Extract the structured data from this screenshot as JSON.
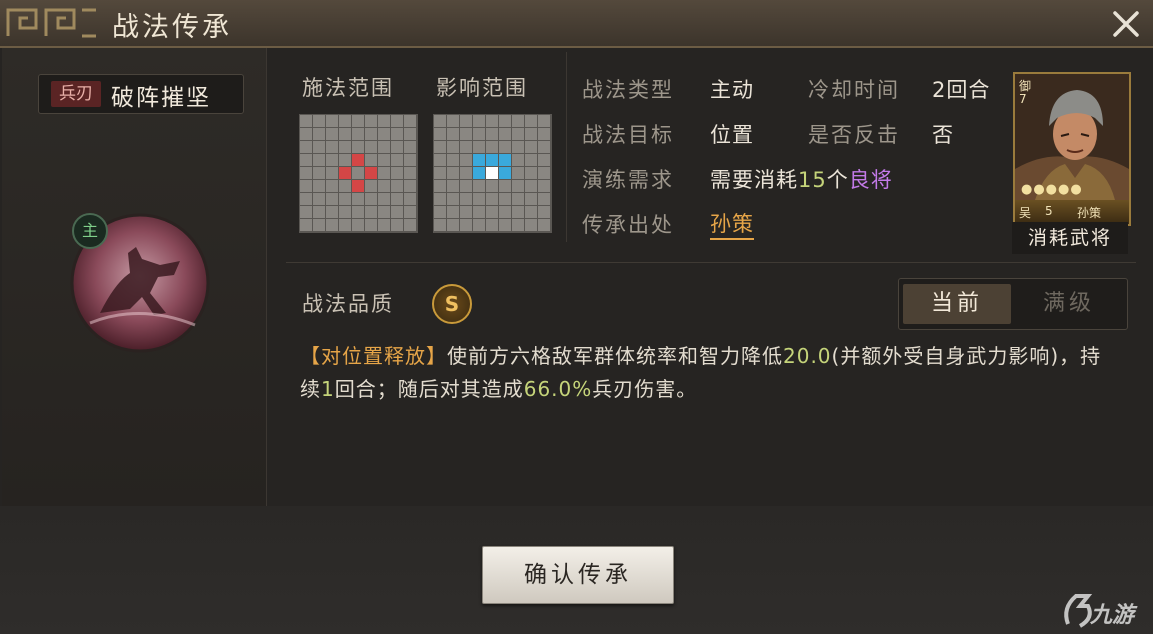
{
  "window": {
    "title": "战法传承",
    "close_icon": "close-icon"
  },
  "skill": {
    "troop_type": "兵刃",
    "name": "破阵摧坚",
    "role_badge": "主"
  },
  "ranges": {
    "cast_label": "施法范围",
    "effect_label": "影响范围",
    "cast_color": "#d44646",
    "effect_color": "#3aa9dc"
  },
  "info": {
    "type_label": "战法类型",
    "type_value": "主动",
    "cooldown_label": "冷却时间",
    "cooldown_value": "2回合",
    "target_label": "战法目标",
    "target_value": "位置",
    "counter_label": "是否反击",
    "counter_value": "否",
    "require_label": "演练需求",
    "require_prefix": "需要消耗",
    "require_count": "15",
    "require_unit": "个",
    "require_item": "良将",
    "origin_label": "传承出处",
    "origin_value": "孙策"
  },
  "general_card": {
    "side_text": "御7",
    "faction": "吴",
    "cost": "5",
    "name": "孙策",
    "stars": "●●●●●",
    "caption": "消耗武将"
  },
  "quality": {
    "label": "战法品质",
    "grade": "S",
    "toggle_current": "当前",
    "toggle_max": "满级"
  },
  "description": {
    "tag": "【对位置释放】",
    "part1": "使前方六格敌军群体统率和智力降低",
    "value1": "20.0",
    "part2": "(并额外受自身武力影响)，持续",
    "value2": "1",
    "part3": "回合；随后对其造成",
    "value3": "66.0%",
    "part4": "兵刃伤害。"
  },
  "actions": {
    "confirm": "确认传承"
  },
  "watermark": {
    "text": "九游"
  }
}
